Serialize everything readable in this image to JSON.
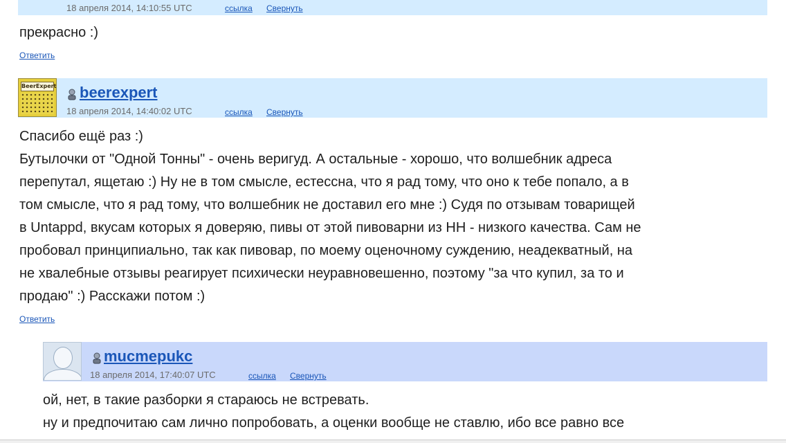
{
  "comments": [
    {
      "date": "18 апреля 2014, 14:10:55 UTC",
      "link_label": "ссылка",
      "collapse_label": "Свернуть",
      "body": [
        "прекрасно :)"
      ],
      "reply_label": "Ответить"
    },
    {
      "username": "beerexpert",
      "avatar_text": "BeerExpert",
      "date": "18 апреля 2014, 14:40:02 UTC",
      "link_label": "ссылка",
      "collapse_label": "Свернуть",
      "body": [
        "Спасибо ещё раз :)",
        "Бутылочки от \"Одной Тонны\" - очень веригуд. А остальные - хорошо, что волшебник адреса",
        "перепутал, ящетаю :) Ну не в том смысле, естессна, что я рад тому, что оно к тебе попало, а в",
        "том смысле, что я рад тому, что волшебник не доставил его мне :) Судя по отзывам товарищей",
        "в Untappd, вкусам которых я доверяю, пивы от этой пивоварни из НН - низкого качества. Сам не",
        "пробовал принципиально, так как пивовар, по моему оценочному суждению, неадекватный, на",
        "не хвалебные отзывы реагирует психически неуравновешенно, поэтому \"за что купил, за то и",
        "продаю\" :) Расскажи потом :)"
      ],
      "reply_label": "Ответить"
    },
    {
      "username": "mucmepukc",
      "date": "18 апреля 2014, 17:40:07 UTC",
      "link_label": "ссылка",
      "collapse_label": "Свернуть",
      "body": [
        "ой, нет, в такие разборки я стараюсь не встревать.",
        "ну и предпочитаю сам лично попробовать, а оценки вообще не ставлю, ибо все равно все"
      ]
    }
  ]
}
